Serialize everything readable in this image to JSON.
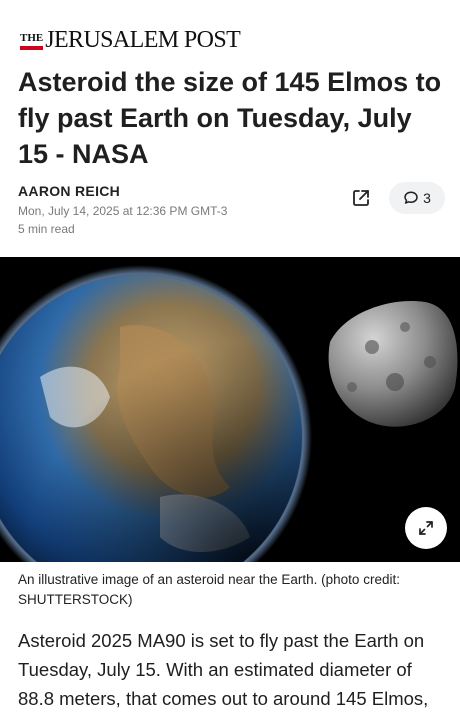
{
  "brand": {
    "the": "THE",
    "name": "JERUSALEM POST"
  },
  "article": {
    "headline": "Asteroid the size of 145 Elmos to fly past Earth on Tuesday, July 15 - NASA",
    "author": "AARON REICH",
    "date": "Mon, July 14, 2025 at 12:36 PM GMT-3",
    "read_time": "5 min read",
    "comment_count": "3",
    "image_caption": "An illustrative image of an asteroid near the Earth. (photo credit: SHUTTERSTOCK)",
    "body": "Asteroid 2025 MA90 is set to fly past the Earth on Tuesday, July 15. With an estimated diameter of 88.8 meters, that comes out to around 145 Elmos,"
  },
  "icons": {
    "share": "share-external-icon",
    "comment": "comment-bubble-icon",
    "expand": "expand-arrows-icon"
  },
  "colors": {
    "brand_red": "#d0021b",
    "headline": "#1f1f1f",
    "meta": "#7a7a7a",
    "comment_pill": "#f1f2f4"
  }
}
